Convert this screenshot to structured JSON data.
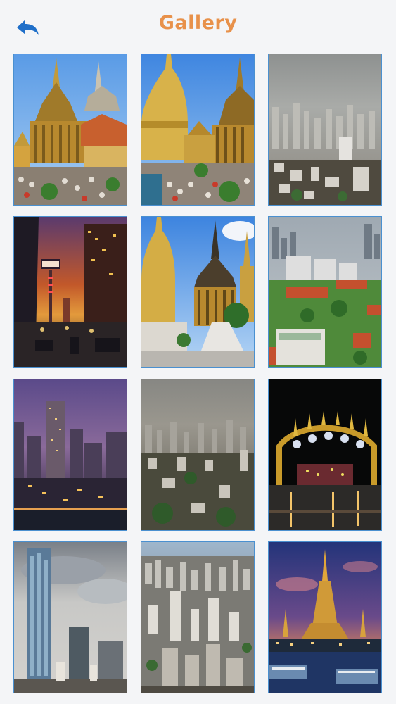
{
  "header": {
    "title": "Gallery",
    "title_color": "#e8914a",
    "back_icon": "back-arrow-icon",
    "back_icon_color": "#1f6fc9"
  },
  "gallery": {
    "border_color": "#4a90d0",
    "photos": [
      {
        "id": "temple-spires-crowd"
      },
      {
        "id": "golden-stupa-temple"
      },
      {
        "id": "hazy-city-skyline"
      },
      {
        "id": "neon-street-sunset"
      },
      {
        "id": "stupa-and-spire-temple"
      },
      {
        "id": "green-rooftops-city"
      },
      {
        "id": "dusk-city-towers"
      },
      {
        "id": "aerial-hazy-city"
      },
      {
        "id": "night-illuminated-arch"
      },
      {
        "id": "pixel-skyscraper"
      },
      {
        "id": "aerial-dense-city"
      },
      {
        "id": "wat-arun-night"
      }
    ]
  }
}
